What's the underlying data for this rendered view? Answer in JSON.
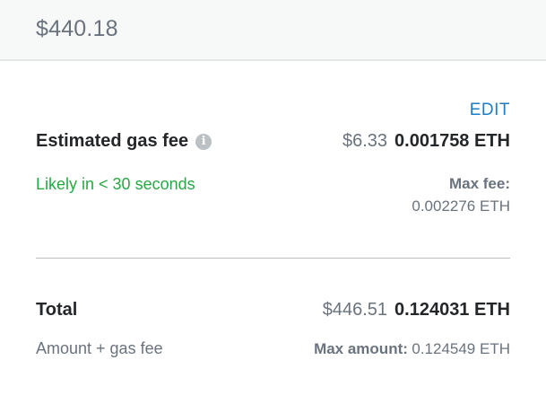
{
  "header": {
    "amount": "$440.18"
  },
  "gas": {
    "edit_label": "EDIT",
    "label": "Estimated gas fee",
    "info_icon": "info-icon",
    "fiat": "$6.33",
    "eth": "0.001758 ETH",
    "likely": "Likely in < 30 seconds",
    "max_fee_label": "Max fee:",
    "max_fee_value": "0.002276 ETH"
  },
  "total": {
    "label": "Total",
    "fiat": "$446.51",
    "eth": "0.124031 ETH",
    "sub_label": "Amount + gas fee",
    "max_amount_label": "Max amount:",
    "max_amount_value": "0.124549 ETH"
  },
  "colors": {
    "accent_blue": "#1f7dc4",
    "success_green": "#28a745",
    "muted_gray": "#6a737d"
  }
}
